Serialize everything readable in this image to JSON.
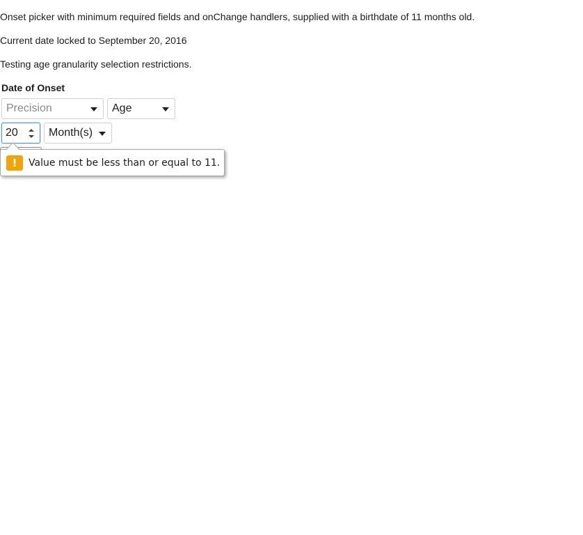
{
  "description": {
    "line1": "Onset picker with minimum required fields and onChange handlers, supplied with a birthdate of 11 months old.",
    "line2": "Current date locked to September 20, 2016",
    "line3": "Testing age granularity selection restrictions."
  },
  "form": {
    "legend": "Date of Onset",
    "precision_select": {
      "placeholder": "Precision",
      "value": ""
    },
    "type_select": {
      "value": "Age"
    },
    "age_input": {
      "value": "20"
    },
    "unit_select": {
      "value": "Month(s)"
    }
  },
  "validation": {
    "message": "Value must be less than or equal to 11.",
    "icon": "warning-icon",
    "icon_glyph": "!",
    "icon_color": "#f0a30a"
  }
}
